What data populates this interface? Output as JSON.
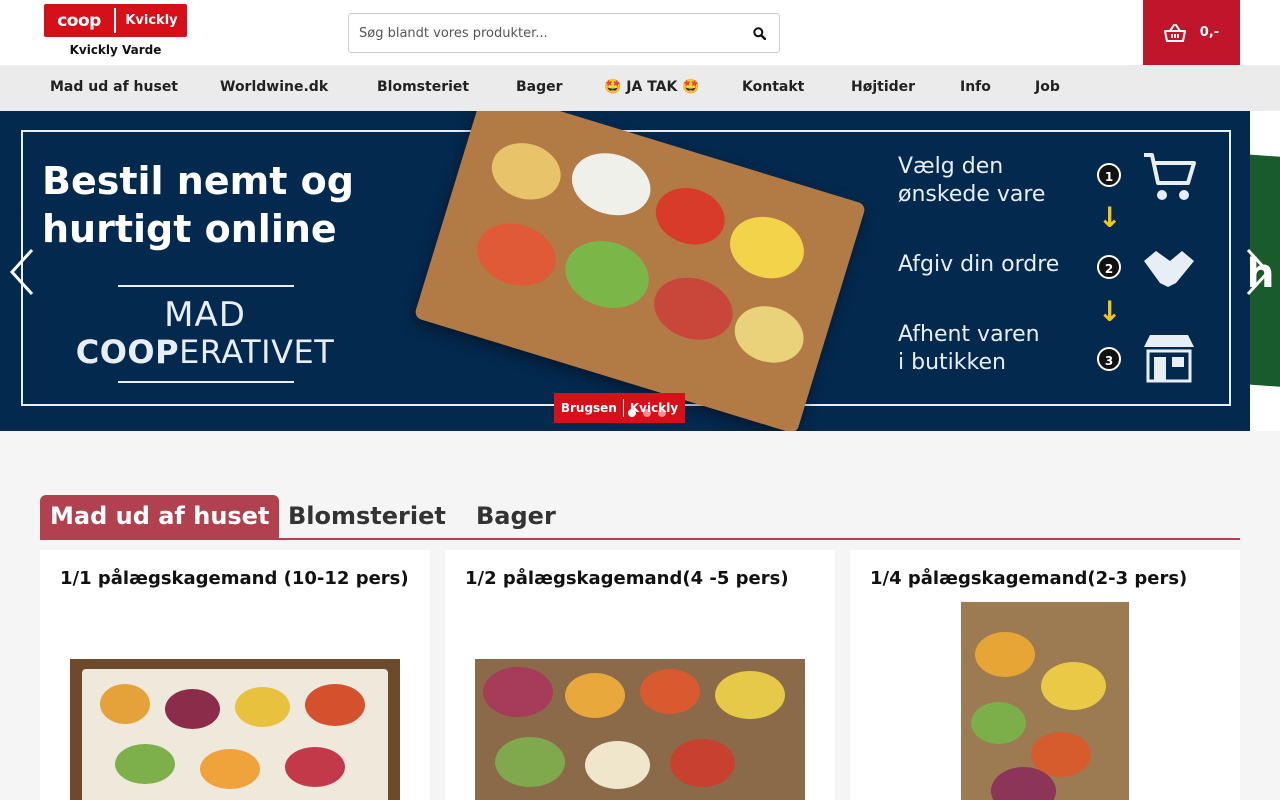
{
  "header": {
    "logo_coop": "coop",
    "logo_kvickly": "Kvickly",
    "store_name": "Kvickly Varde",
    "search_placeholder": "Søg blandt vores produkter...",
    "cart_count": "0,-",
    "colors": {
      "brand_red": "#d51018",
      "cart_bg": "#c0152a"
    }
  },
  "nav": {
    "items": [
      {
        "label": "Mad ud af huset"
      },
      {
        "label": "Worldwine.dk"
      },
      {
        "label": "Blomsteriet"
      },
      {
        "label": "Bager"
      },
      {
        "label": "🤩 JA TAK 🤩"
      },
      {
        "label": "Kontakt"
      },
      {
        "label": "Højtider"
      },
      {
        "label": "Info"
      },
      {
        "label": "Job"
      }
    ]
  },
  "banner": {
    "headline_1": "Bestil nemt og",
    "headline_2": "hurtigt online",
    "mad": "MAD",
    "coop_bold": "COOP",
    "coop_rest": "ERATIVET",
    "steps": [
      {
        "num": "1",
        "line1": "Vælg den",
        "line2": "ønskede vare",
        "icon": "cart-icon"
      },
      {
        "num": "2",
        "line1": "Afgiv din ordre",
        "line2": "",
        "icon": "handshake-icon"
      },
      {
        "num": "3",
        "line1": "Afhent varen",
        "line2": "i butikken",
        "icon": "store-icon"
      }
    ],
    "badge_left": "Brugsen",
    "badge_right": "Kvickly",
    "next_slide_text": "h",
    "active_slide": 1,
    "slide_count": 3,
    "colors": {
      "bg": "#04294f",
      "accent_yellow": "#f2c71c"
    }
  },
  "tabs": {
    "items": [
      {
        "label": "Mad ud af huset",
        "active": true
      },
      {
        "label": "Blomsteriet",
        "active": false
      },
      {
        "label": "Bager",
        "active": false
      }
    ],
    "accent": "#b2414f"
  },
  "products": [
    {
      "title": "1/1 pålægskagemand (10-12 pers)"
    },
    {
      "title": "1/2 pålægskagemand(4 -5 pers)"
    },
    {
      "title": "1/4 pålægskagemand(2-3 pers)"
    }
  ]
}
